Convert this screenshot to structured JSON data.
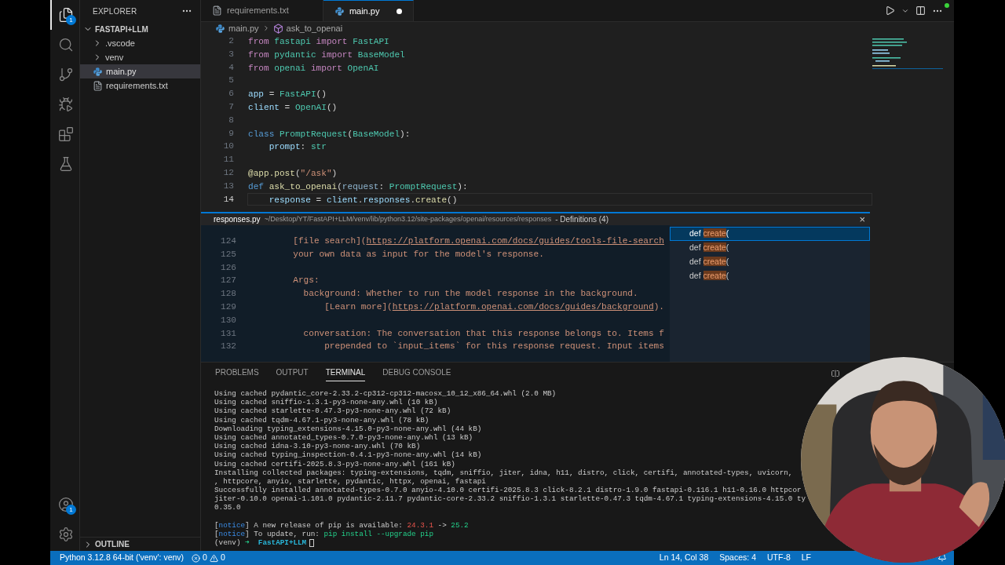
{
  "activity_bar": {
    "items": [
      {
        "kind": "files",
        "badge": "1",
        "selected": true
      },
      {
        "kind": "search",
        "selected": false
      },
      {
        "kind": "source-control",
        "selected": false
      },
      {
        "kind": "run-debug",
        "selected": false
      },
      {
        "kind": "extensions",
        "selected": false
      },
      {
        "kind": "testing",
        "selected": false
      }
    ],
    "bottom": [
      {
        "kind": "account",
        "badge": "1"
      },
      {
        "kind": "settings"
      }
    ]
  },
  "sidebar": {
    "title": "EXPLORER",
    "folder": {
      "name": "FASTAPI+LLM",
      "expanded": true,
      "children": [
        {
          "name": ".vscode",
          "kind": "folder",
          "expanded": false,
          "selected": false
        },
        {
          "name": "venv",
          "kind": "folder",
          "expanded": false,
          "selected": false
        },
        {
          "name": "main.py",
          "kind": "python",
          "selected": true
        },
        {
          "name": "requirements.txt",
          "kind": "text",
          "selected": false
        }
      ]
    },
    "outline": {
      "title": "OUTLINE",
      "expanded": false
    }
  },
  "tabs": [
    {
      "label": "requirements.txt",
      "kind": "text",
      "selected": false,
      "modified": false
    },
    {
      "label": "main.py",
      "kind": "python",
      "selected": true,
      "modified": true
    }
  ],
  "breadcrumb": [
    {
      "label": "main.py",
      "kind": "python"
    },
    {
      "label": "ask_to_openai",
      "kind": "method"
    }
  ],
  "editor": {
    "lines": [
      {
        "number": "2",
        "tokens": [
          {
            "text": "from",
            "kind": "keyword"
          },
          {
            "text": " fastapi ",
            "kind": "type"
          },
          {
            "text": "import",
            "kind": "keyword"
          },
          {
            "text": " FastAPI",
            "kind": "type"
          }
        ]
      },
      {
        "number": "3",
        "tokens": [
          {
            "text": "from",
            "kind": "keyword"
          },
          {
            "text": " pydantic ",
            "kind": "type"
          },
          {
            "text": "import",
            "kind": "keyword"
          },
          {
            "text": " BaseModel",
            "kind": "type"
          }
        ]
      },
      {
        "number": "4",
        "tokens": [
          {
            "text": "from",
            "kind": "keyword"
          },
          {
            "text": " openai ",
            "kind": "type"
          },
          {
            "text": "import",
            "kind": "keyword"
          },
          {
            "text": " OpenAI",
            "kind": "type"
          }
        ]
      },
      {
        "number": "5"
      },
      {
        "number": "6",
        "tokens": [
          {
            "text": "app",
            "kind": "variable"
          },
          {
            "text": " = ",
            "kind": "text"
          },
          {
            "text": "FastAPI",
            "kind": "type"
          },
          {
            "text": "()",
            "kind": "text"
          }
        ]
      },
      {
        "number": "7",
        "tokens": [
          {
            "text": "client",
            "kind": "variable"
          },
          {
            "text": " = ",
            "kind": "text"
          },
          {
            "text": "OpenAI",
            "kind": "type"
          },
          {
            "text": "()",
            "kind": "text"
          }
        ]
      },
      {
        "number": "8"
      },
      {
        "number": "9",
        "tokens": [
          {
            "text": "class",
            "kind": "storage"
          },
          {
            "text": " PromptRequest",
            "kind": "type"
          },
          {
            "text": "(",
            "kind": "text"
          },
          {
            "text": "BaseModel",
            "kind": "type"
          },
          {
            "text": "):",
            "kind": "text"
          }
        ]
      },
      {
        "number": "10",
        "tokens": [
          {
            "text": "    prompt",
            "kind": "variable"
          },
          {
            "text": ": ",
            "kind": "text"
          },
          {
            "text": "str",
            "kind": "type"
          }
        ]
      },
      {
        "number": "11"
      },
      {
        "number": "12",
        "tokens": [
          {
            "text": "@app.post",
            "kind": "function"
          },
          {
            "text": "(",
            "kind": "text"
          },
          {
            "text": "\"/ask\"",
            "kind": "string"
          },
          {
            "text": ")",
            "kind": "text"
          }
        ]
      },
      {
        "number": "13",
        "tokens": [
          {
            "text": "def",
            "kind": "storage"
          },
          {
            "text": " ask_to_openai",
            "kind": "function"
          },
          {
            "text": "(",
            "kind": "text"
          },
          {
            "text": "request",
            "kind": "param"
          },
          {
            "text": ": ",
            "kind": "text"
          },
          {
            "text": "PromptRequest",
            "kind": "type"
          },
          {
            "text": "):",
            "kind": "text"
          }
        ]
      },
      {
        "number": "14",
        "current": true,
        "tokens": [
          {
            "text": "    response",
            "kind": "variable"
          },
          {
            "text": " = ",
            "kind": "text"
          },
          {
            "text": "client",
            "kind": "variable"
          },
          {
            "text": ".",
            "kind": "text"
          },
          {
            "text": "responses",
            "kind": "variable"
          },
          {
            "text": ".",
            "kind": "text"
          },
          {
            "text": "create",
            "kind": "function"
          },
          {
            "text": "()",
            "kind": "text"
          }
        ]
      }
    ]
  },
  "peek": {
    "file": "responses.py",
    "path": "~/Desktop/YT/FastAPI+LLM/venv/lib/python3.12/site-packages/openai/resources/responses",
    "title": "- Definitions (4)",
    "close": "×",
    "lines": [
      {
        "number": "124",
        "segments": [
          {
            "text": "        [file search](",
            "kind": "text"
          },
          {
            "text": "https://platform.openai.com/docs/guides/tools-file-search",
            "kind": "link"
          }
        ]
      },
      {
        "number": "125",
        "segments": [
          {
            "text": "        your own data as input for the model's response.",
            "kind": "text"
          }
        ]
      },
      {
        "number": "126"
      },
      {
        "number": "127",
        "segments": [
          {
            "text": "        Args:",
            "kind": "text"
          }
        ]
      },
      {
        "number": "128",
        "segments": [
          {
            "text": "          background: Whether to run the model response in the background.",
            "kind": "text"
          }
        ]
      },
      {
        "number": "129",
        "segments": [
          {
            "text": "              [Learn more](",
            "kind": "text"
          },
          {
            "text": "https://platform.openai.com/docs/guides/background",
            "kind": "link"
          },
          {
            "text": ").",
            "kind": "text"
          }
        ]
      },
      {
        "number": "130"
      },
      {
        "number": "131",
        "segments": [
          {
            "text": "          conversation: The conversation that this response belongs to. Items f",
            "kind": "text"
          }
        ]
      },
      {
        "number": "132",
        "segments": [
          {
            "text": "              prepended to `input_items` for this response request. Input items",
            "kind": "text"
          }
        ]
      }
    ],
    "definitions": [
      {
        "keyword": "def",
        "match": "create",
        "rest": "(",
        "selected": true
      },
      {
        "keyword": "def",
        "match": "create",
        "rest": "(",
        "selected": false
      },
      {
        "keyword": "def",
        "match": "create",
        "rest": "(",
        "selected": false
      },
      {
        "keyword": "def",
        "match": "create",
        "rest": "(",
        "selected": false
      }
    ]
  },
  "panel": {
    "tabs": [
      {
        "label": "PROBLEMS",
        "selected": false
      },
      {
        "label": "OUTPUT",
        "selected": false
      },
      {
        "label": "TERMINAL",
        "selected": true
      },
      {
        "label": "DEBUG CONSOLE",
        "selected": false
      }
    ],
    "terminal": [
      {
        "kind": "plain",
        "text": "Using cached pydantic_core-2.33.2-cp312-cp312-macosx_10_12_x86_64.whl (2.0 MB)"
      },
      {
        "kind": "plain",
        "text": "Using cached sniffio-1.3.1-py3-none-any.whl (10 kB)"
      },
      {
        "kind": "plain",
        "text": "Using cached starlette-0.47.3-py3-none-any.whl (72 kB)"
      },
      {
        "kind": "plain",
        "text": "Using cached tqdm-4.67.1-py3-none-any.whl (78 kB)"
      },
      {
        "kind": "plain",
        "text": "Downloading typing_extensions-4.15.0-py3-none-any.whl (44 kB)"
      },
      {
        "kind": "plain",
        "text": "Using cached annotated_types-0.7.0-py3-none-any.whl (13 kB)"
      },
      {
        "kind": "plain",
        "text": "Using cached idna-3.10-py3-none-any.whl (70 kB)"
      },
      {
        "kind": "plain",
        "text": "Using cached typing_inspection-0.4.1-py3-none-any.whl (14 kB)"
      },
      {
        "kind": "plain",
        "text": "Using cached certifi-2025.8.3-py3-none-any.whl (161 kB)"
      },
      {
        "kind": "plain",
        "text": "Installing collected packages: typing-extensions, tqdm, sniffio, jiter, idna, h11, distro, click, certifi, annotated-types, uvicorn,"
      },
      {
        "kind": "plain",
        "text": ", httpcore, anyio, starlette, pydantic, httpx, openai, fastapi"
      },
      {
        "kind": "plain",
        "text": "Successfully installed annotated-types-0.7.0 anyio-4.10.0 certifi-2025.8.3 click-8.2.1 distro-1.9.0 fastapi-0.116.1 h11-0.16.0 httpcor"
      },
      {
        "kind": "plain",
        "text": "jiter-0.10.0 openai-1.101.0 pydantic-2.11.7 pydantic-core-2.33.2 sniffio-1.3.1 starlette-0.47.3 tqdm-4.67.1 typing-extensions-4.15.0 ty"
      },
      {
        "kind": "plain",
        "text": "0.35.0"
      },
      {
        "kind": "blank"
      },
      {
        "kind": "colored",
        "segments": [
          {
            "text": "[",
            "kind": "text"
          },
          {
            "text": "notice",
            "kind": "notice"
          },
          {
            "text": "] A new release of pip is available: ",
            "kind": "text"
          },
          {
            "text": "24.3.1",
            "kind": "old"
          },
          {
            "text": " -> ",
            "kind": "text"
          },
          {
            "text": "25.2",
            "kind": "new"
          }
        ]
      },
      {
        "kind": "colored",
        "segments": [
          {
            "text": "[",
            "kind": "text"
          },
          {
            "text": "notice",
            "kind": "notice"
          },
          {
            "text": "] To update, run: ",
            "kind": "text"
          },
          {
            "text": "pip install --upgrade pip",
            "kind": "new"
          }
        ]
      },
      {
        "kind": "prompt",
        "segments": [
          {
            "text": "(venv) ",
            "kind": "text"
          },
          {
            "text": "➜",
            "kind": "arrow"
          },
          {
            "text": "  FastAPI+LLM",
            "kind": "dir"
          }
        ]
      }
    ]
  },
  "status_bar": {
    "interpreter": "Python 3.12.8 64-bit ('venv': venv)",
    "errors": "0",
    "warnings": "0",
    "items": [
      "Ln 14, Col 38",
      "Spaces: 4",
      "UTF-8",
      "LF"
    ]
  }
}
